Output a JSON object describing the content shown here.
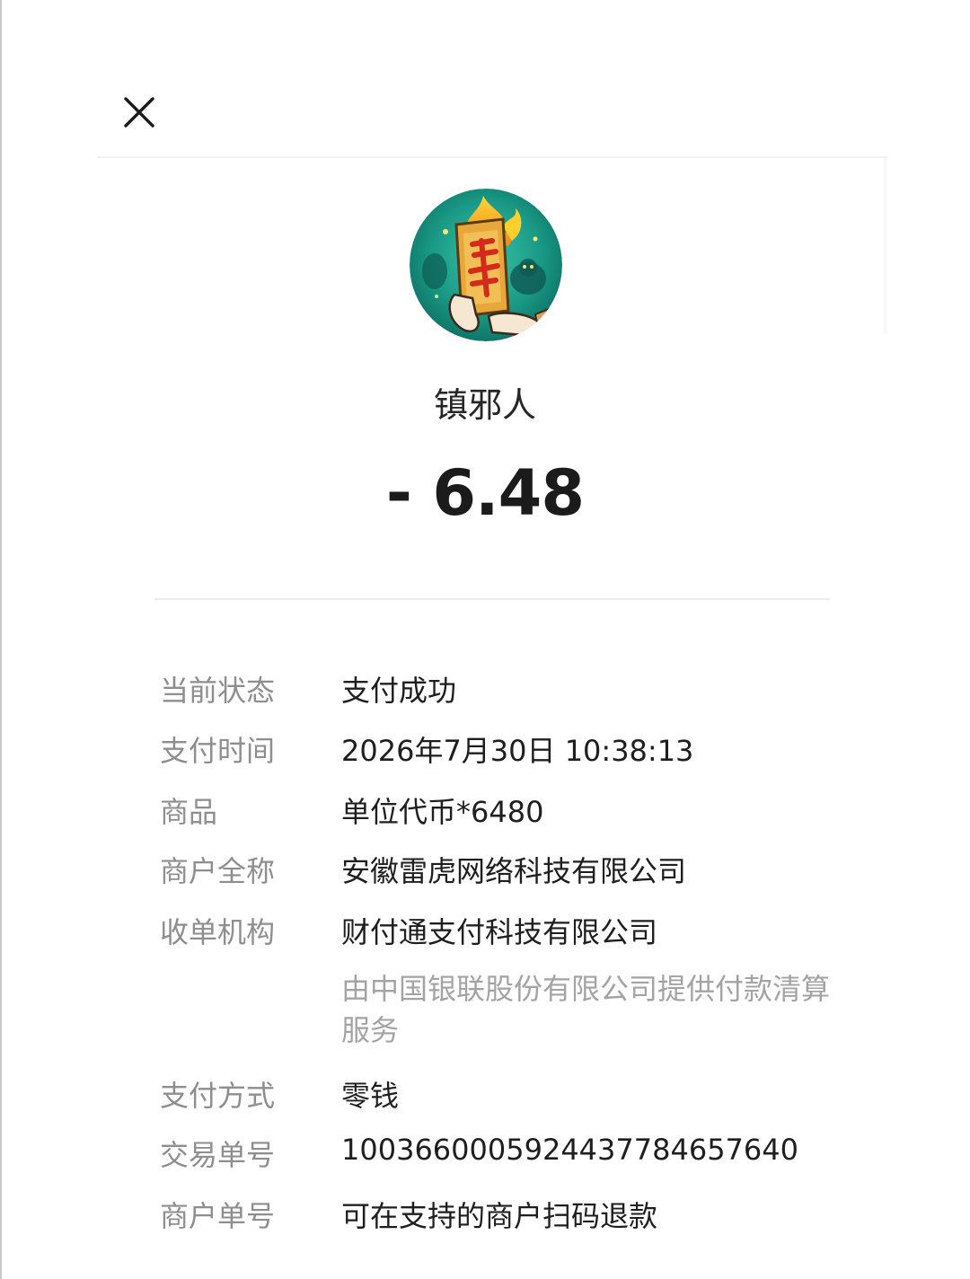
{
  "header": {
    "close_icon": "close-icon"
  },
  "merchant": {
    "avatar_icon": "merchant-avatar",
    "name": "镇邪人",
    "amount": "- 6.48"
  },
  "details": {
    "status_label": "当前状态",
    "status_value": "支付成功",
    "time_label": "支付时间",
    "time_value": "2026年7月30日  10:38:13",
    "product_label": "商品",
    "product_value": "单位代币*6480",
    "merchant_fullname_label": "商户全称",
    "merchant_fullname_value": "安徽雷虎网络科技有限公司",
    "acquirer_label": "收单机构",
    "acquirer_value": "财付通支付科技有限公司",
    "acquirer_note": "由中国银联股份有限公司提供付款清算服务",
    "method_label": "支付方式",
    "method_value": "零钱",
    "transaction_no_label": "交易单号",
    "transaction_no_value": "100366000592443778465764​0",
    "merchant_no_label": "商户单号",
    "merchant_no_value": "可在支持的商户扫码退款"
  }
}
